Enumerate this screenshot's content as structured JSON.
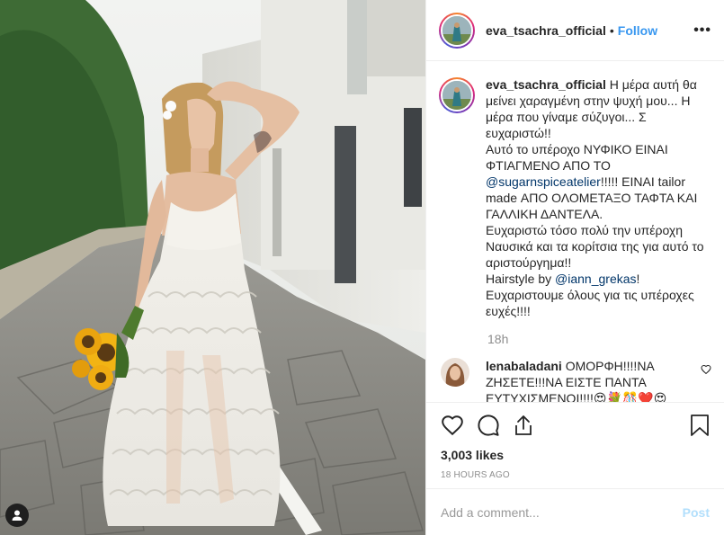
{
  "post": {
    "username": "eva_tsachra_official",
    "separator": "•",
    "follow_label": "Follow",
    "more_label": "•••",
    "caption_lines": "Η μέρα αυτή θα μείνει χαραγμένη στην ψυχή μου... Η μέρα που γίναμε σύζυγοι... Σ ευχαριστώ!!\nΑυτό το υπέροχο ΝΥΦΙΚΟ ΕΙΝΑΙ ΦΤΙΑΓΜΕΝΟ ΑΠΟ ΤΟ ",
    "caption_mention_1": "@sugarnspiceatelier",
    "caption_mid": "!!!!! ΕΙΝΑΙ tailor made ΑΠΟ ΟΛΟΜΕΤΑΞΟ ΤΑΦΤΑ ΚΑΙ ΓΑΛΛΙΚΗ ΔΑΝΤΕΛΑ.\nΕυχαριστώ τόσο πολύ την υπέροχη Ναυσικά και τα κορίτσια της για αυτό το αριστούργημα!!\nHairstyle by ",
    "caption_mention_2": "@iann_grekas",
    "caption_end": "!\nΕυχαριστουμε όλους για τις υπέροχες ευχές!!!!",
    "caption_time": "18h",
    "likes": "3,003 likes",
    "posted_ago": "18 HOURS AGO",
    "comment_placeholder": "Add a comment...",
    "post_button": "Post"
  },
  "comments": [
    {
      "username": "lenabaladani",
      "text": "ΟΜΟΡΦΗ!!!!ΝΑ ΖΗΣΕΤΕ!!!ΝΑ ΕΙΣΤΕ ΠΑΝΤΑ ΕΥΤΥΧΙΣΜΕΝΟΙ!!!!😍💐🎊❤️😍"
    }
  ],
  "icons": {
    "like": "heart-icon",
    "comment": "comment-icon",
    "share": "share-icon",
    "save": "bookmark-icon",
    "comment_like": "heart-small-icon",
    "tag": "person-tag-icon",
    "more": "more-options-icon"
  },
  "colors": {
    "accent": "#3897f0",
    "post_disabled": "#b2dffc",
    "muted": "#8e8e8e",
    "mention": "#003569"
  }
}
